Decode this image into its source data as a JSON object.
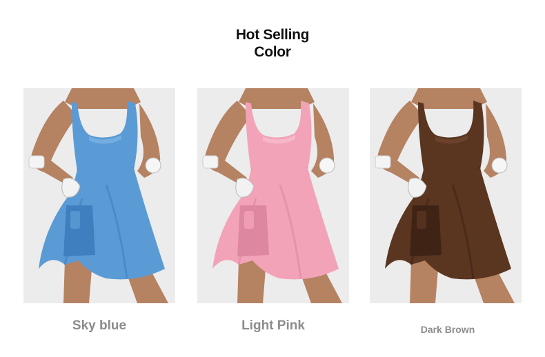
{
  "header": {
    "title_line1": "Hot Selling",
    "title_line2": "Color"
  },
  "products": [
    {
      "label": "Sky blue",
      "color": "#5b9bd5",
      "shade": "#3f7fbf",
      "highlight": "#7fb6e6",
      "icon": "dress-photo-icon"
    },
    {
      "label": "Light Pink",
      "color": "#f2a3b8",
      "shade": "#de87a0",
      "highlight": "#f8c0cf",
      "icon": "dress-photo-icon"
    },
    {
      "label": "Dark Brown",
      "color": "#5a3520",
      "shade": "#3f2415",
      "highlight": "#74492f",
      "icon": "dress-photo-icon"
    }
  ],
  "colors": {
    "background": "#ffffff",
    "photo_background": "#ececec",
    "skin": "#b58262",
    "caption": "#8c8c8c"
  }
}
